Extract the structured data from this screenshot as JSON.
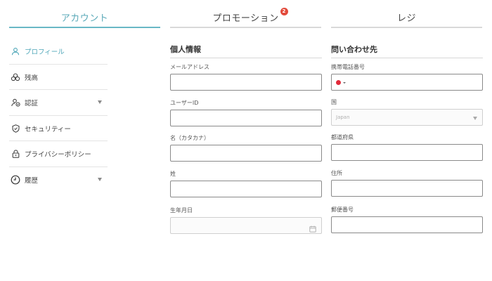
{
  "tabs": [
    {
      "label": "アカウント",
      "active": true
    },
    {
      "label": "プロモーション",
      "active": false,
      "badge": "2"
    },
    {
      "label": "レジ",
      "active": false
    }
  ],
  "sidebar": {
    "items": [
      {
        "label": "プロフィール",
        "icon": "user-icon",
        "active": true,
        "expandable": false
      },
      {
        "label": "残高",
        "icon": "coins-icon",
        "active": false,
        "expandable": false
      },
      {
        "label": "認証",
        "icon": "user-check-icon",
        "active": false,
        "expandable": true
      },
      {
        "label": "セキュリティー",
        "icon": "shield-icon",
        "active": false,
        "expandable": false
      },
      {
        "label": "プライバシーポリシー",
        "icon": "lock-icon",
        "active": false,
        "expandable": false
      },
      {
        "label": "履歴",
        "icon": "clock-icon",
        "active": false,
        "expandable": true
      }
    ]
  },
  "personal": {
    "title": "個人情報",
    "email_label": "メールアドレス",
    "userid_label": "ユーザーID",
    "first_name_label": "名（カタカナ）",
    "last_name_label": "姓",
    "birthdate_label": "生年月日"
  },
  "contact": {
    "title": "問い合わせ先",
    "phone_label": "携帯電話番号",
    "country_label": "国",
    "country_value": "Japan",
    "prefecture_label": "都道府県",
    "address_label": "住所",
    "postal_label": "郵便番号"
  },
  "colors": {
    "accent": "#5aa9b8",
    "badge": "#e24a3b",
    "flag": "#e12a3a"
  }
}
